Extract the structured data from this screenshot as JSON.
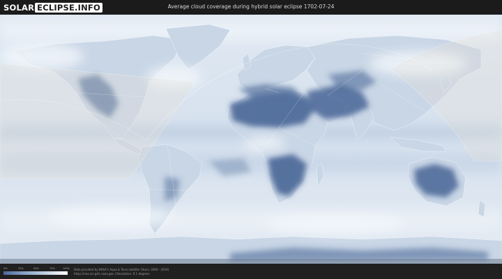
{
  "header": {
    "logo_word1": "SOLAR",
    "logo_word2": "ECLIPSE.INFO",
    "title": "Average cloud coverage during hybrid solar eclipse 1702-07-24"
  },
  "legend": {
    "ticks": [
      "0%",
      "25%",
      "50%",
      "75%",
      "100%"
    ],
    "color_low": "#4a6a9c",
    "color_high": "#ffffff"
  },
  "footer": {
    "credit_line1": "Data provided by NASA's Aqua & Terra satellite (Years: 2000 - 2019)",
    "credit_line2": "https://neo.sci.gsfc.nasa.gov | Resolution: 0.1 degrees"
  },
  "colors": {
    "ocean_cloud": "#dbe5f0",
    "clear_land": "#4e6b99",
    "border": "#ffffff"
  }
}
